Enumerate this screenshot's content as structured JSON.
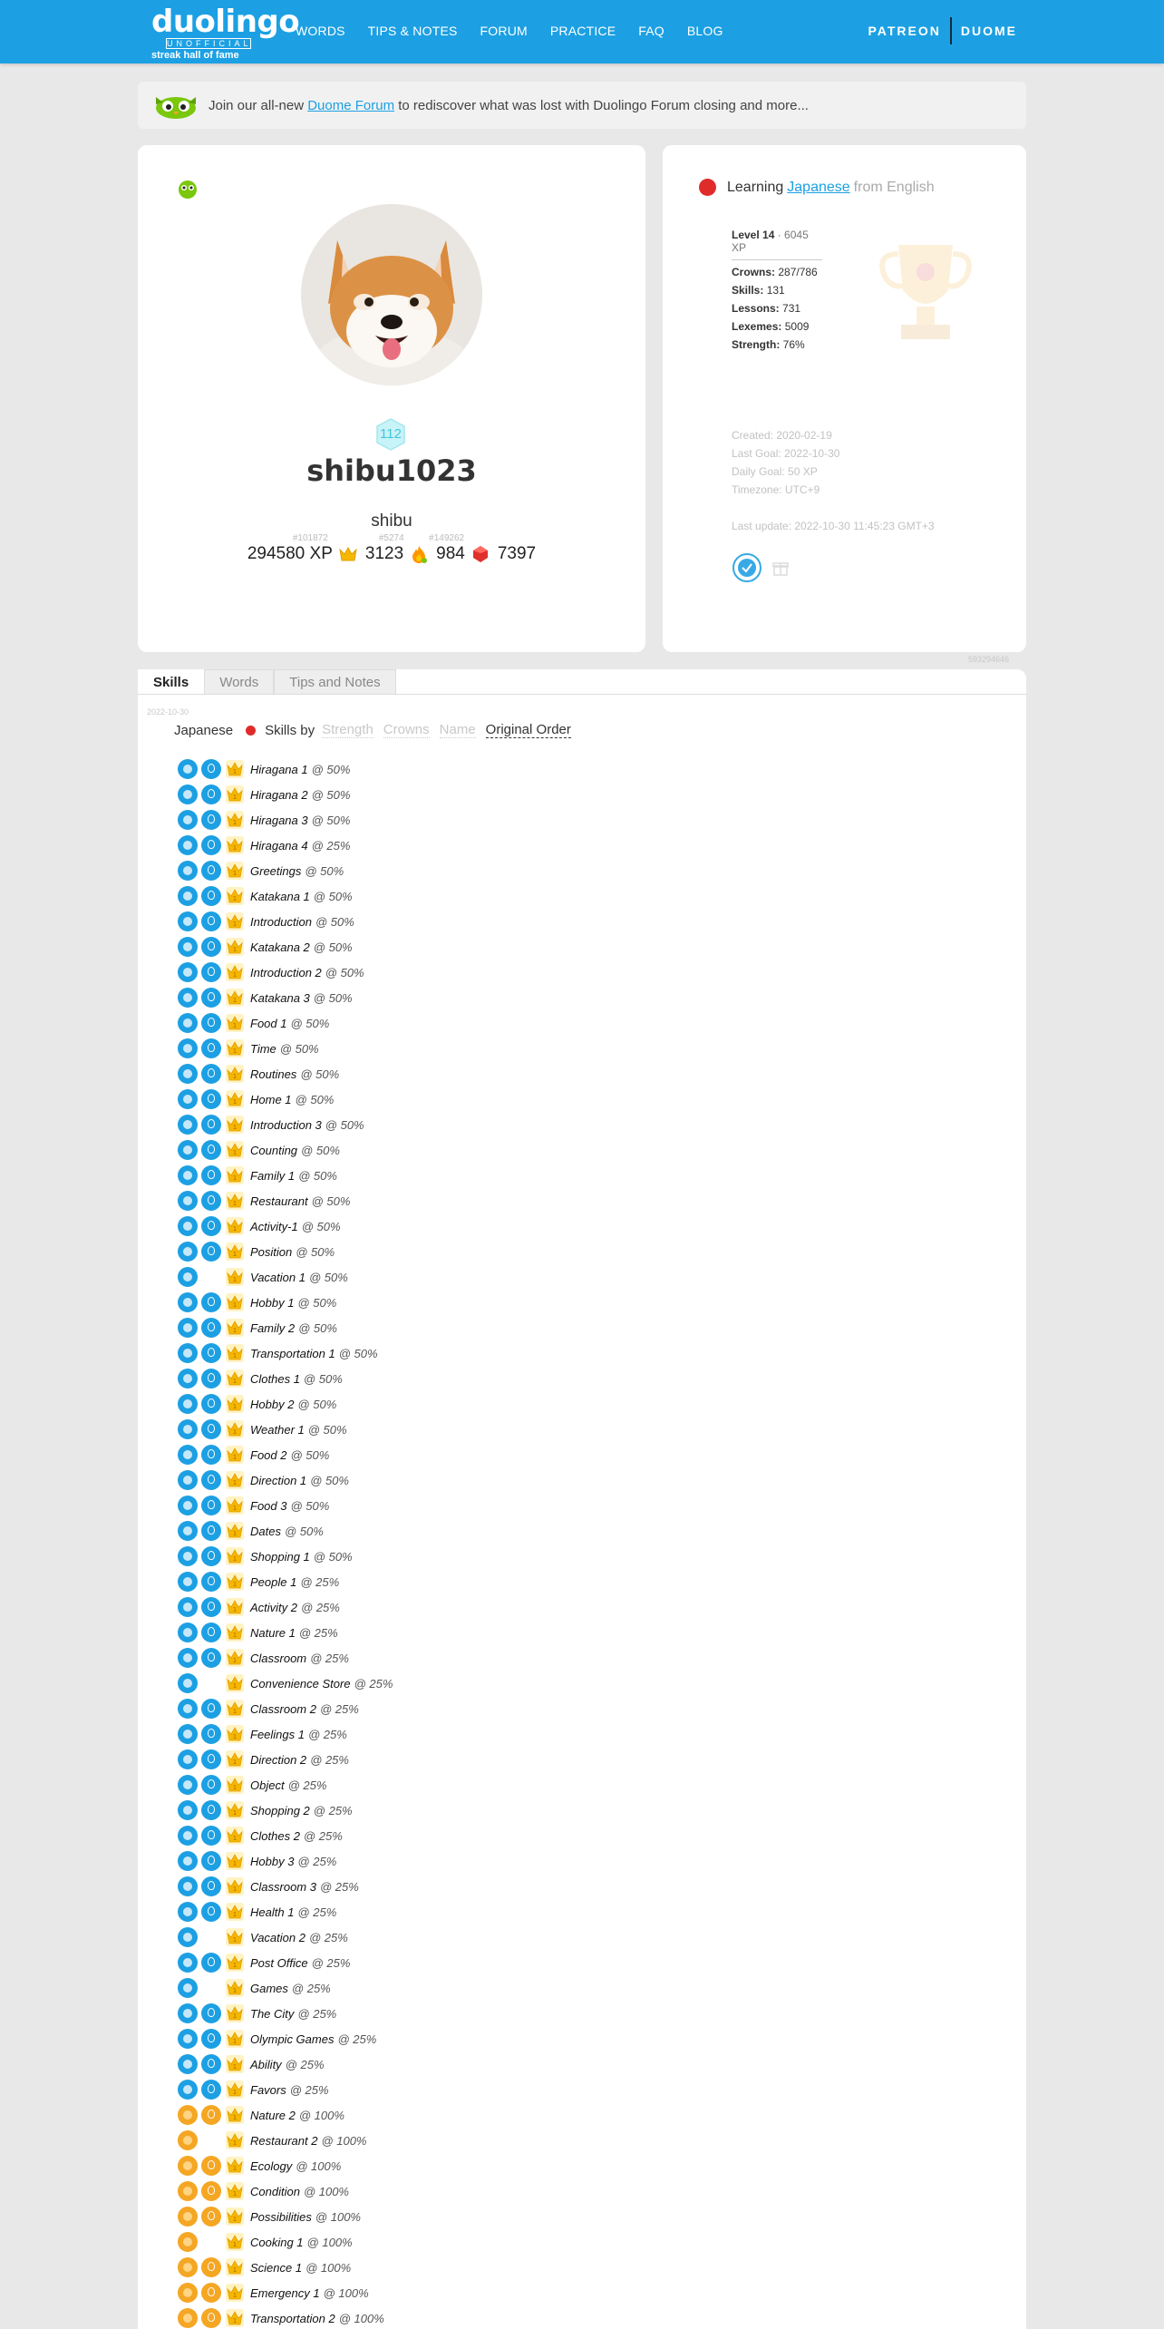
{
  "nav": {
    "logo": "duolingo",
    "logo_sub": "UNOFFICIAL",
    "logo_tag": "streak hall of fame",
    "links": [
      "WORDS",
      "TIPS & NOTES",
      "FORUM",
      "PRACTICE",
      "FAQ",
      "BLOG"
    ],
    "patreon": "PATREON",
    "duome": "DUOME"
  },
  "banner": {
    "pre": "Join our all-new ",
    "link": "Duome Forum",
    "post": " to rediscover what was lost with Duolingo Forum closing and more..."
  },
  "profile": {
    "level_badge": "112",
    "username": "shibu1023",
    "display_name": "shibu",
    "xp_rank": "#101872",
    "xp": "294580 XP",
    "crowns_rank": "#5274",
    "crowns": "3123",
    "streak_rank": "#149262",
    "streak": "984",
    "gems": "7397"
  },
  "learning": {
    "learning_label": "Learning",
    "language": "Japanese",
    "from": "from English",
    "level_label": "Level 14",
    "level_xp": "· 6045 XP",
    "crowns_label": "Crowns:",
    "crowns": "287/786",
    "skills_label": "Skills:",
    "skills": "131",
    "lessons_label": "Lessons:",
    "lessons": "731",
    "lexemes_label": "Lexemes:",
    "lexemes": "5009",
    "strength_label": "Strength:",
    "strength": "76%",
    "created": "Created: 2020-02-19",
    "last_goal": "Last Goal: 2022-10-30",
    "daily_goal": "Daily Goal: 50 XP",
    "timezone": "Timezone: UTC+9",
    "last_update": "Last update: 2022-10-30 11:45:23 GMT+3",
    "id_number": "593294646"
  },
  "skills_section": {
    "tabs": [
      "Skills",
      "Words",
      "Tips and Notes"
    ],
    "date": "2022-10-30",
    "language": "Japanese",
    "skills_by": "Skills by",
    "sort_options": [
      "Strength",
      "Crowns",
      "Name",
      "Original Order"
    ],
    "items": [
      {
        "name": "Hiragana 1",
        "pct": "@ 50%",
        "tip": "blue",
        "icon": "blue"
      },
      {
        "name": "Hiragana 2",
        "pct": "@ 50%",
        "tip": "blue",
        "icon": "blue"
      },
      {
        "name": "Hiragana 3",
        "pct": "@ 50%",
        "tip": "blue",
        "icon": "blue"
      },
      {
        "name": "Hiragana 4",
        "pct": "@ 25%",
        "tip": "blue",
        "icon": "blue"
      },
      {
        "name": "Greetings",
        "pct": "@ 50%",
        "tip": "blue",
        "icon": "blue"
      },
      {
        "name": "Katakana 1",
        "pct": "@ 50%",
        "tip": "blue",
        "icon": "blue"
      },
      {
        "name": "Introduction",
        "pct": "@ 50%",
        "tip": "blue",
        "icon": "blue"
      },
      {
        "name": "Katakana 2",
        "pct": "@ 50%",
        "tip": "blue",
        "icon": "blue"
      },
      {
        "name": "Introduction 2",
        "pct": "@ 50%",
        "tip": "blue",
        "icon": "blue"
      },
      {
        "name": "Katakana 3",
        "pct": "@ 50%",
        "tip": "blue",
        "icon": "blue"
      },
      {
        "name": "Food 1",
        "pct": "@ 50%",
        "tip": "blue",
        "icon": "blue"
      },
      {
        "name": "Time",
        "pct": "@ 50%",
        "tip": "blue",
        "icon": "blue"
      },
      {
        "name": "Routines",
        "pct": "@ 50%",
        "tip": "blue",
        "icon": "blue"
      },
      {
        "name": "Home 1",
        "pct": "@ 50%",
        "tip": "blue",
        "icon": "blue"
      },
      {
        "name": "Introduction 3",
        "pct": "@ 50%",
        "tip": "blue",
        "icon": "blue"
      },
      {
        "name": "Counting",
        "pct": "@ 50%",
        "tip": "blue",
        "icon": "blue"
      },
      {
        "name": "Family 1",
        "pct": "@ 50%",
        "tip": "blue",
        "icon": "blue"
      },
      {
        "name": "Restaurant",
        "pct": "@ 50%",
        "tip": "blue",
        "icon": "blue"
      },
      {
        "name": "Activity-1",
        "pct": "@ 50%",
        "tip": "blue",
        "icon": "blue"
      },
      {
        "name": "Position",
        "pct": "@ 50%",
        "tip": "blue",
        "icon": "blue"
      },
      {
        "name": "Vacation 1",
        "pct": "@ 50%",
        "tip": "none",
        "icon": "blue"
      },
      {
        "name": "Hobby 1",
        "pct": "@ 50%",
        "tip": "blue",
        "icon": "blue"
      },
      {
        "name": "Family 2",
        "pct": "@ 50%",
        "tip": "blue",
        "icon": "blue"
      },
      {
        "name": "Transportation 1",
        "pct": "@ 50%",
        "tip": "blue",
        "icon": "blue"
      },
      {
        "name": "Clothes 1",
        "pct": "@ 50%",
        "tip": "blue",
        "icon": "blue"
      },
      {
        "name": "Hobby 2",
        "pct": "@ 50%",
        "tip": "blue",
        "icon": "blue"
      },
      {
        "name": "Weather 1",
        "pct": "@ 50%",
        "tip": "blue",
        "icon": "blue"
      },
      {
        "name": "Food 2",
        "pct": "@ 50%",
        "tip": "blue",
        "icon": "blue"
      },
      {
        "name": "Direction 1",
        "pct": "@ 50%",
        "tip": "blue",
        "icon": "blue"
      },
      {
        "name": "Food 3",
        "pct": "@ 50%",
        "tip": "blue",
        "icon": "blue"
      },
      {
        "name": "Dates",
        "pct": "@ 50%",
        "tip": "blue",
        "icon": "blue"
      },
      {
        "name": "Shopping 1",
        "pct": "@ 50%",
        "tip": "blue",
        "icon": "blue"
      },
      {
        "name": "People 1",
        "pct": "@ 25%",
        "tip": "blue",
        "icon": "blue"
      },
      {
        "name": "Activity 2",
        "pct": "@ 25%",
        "tip": "blue",
        "icon": "blue"
      },
      {
        "name": "Nature 1",
        "pct": "@ 25%",
        "tip": "blue",
        "icon": "blue"
      },
      {
        "name": "Classroom",
        "pct": "@ 25%",
        "tip": "blue",
        "icon": "blue"
      },
      {
        "name": "Convenience Store",
        "pct": "@ 25%",
        "tip": "none",
        "icon": "blue"
      },
      {
        "name": "Classroom 2",
        "pct": "@ 25%",
        "tip": "blue",
        "icon": "blue"
      },
      {
        "name": "Feelings 1",
        "pct": "@ 25%",
        "tip": "blue",
        "icon": "blue"
      },
      {
        "name": "Direction 2",
        "pct": "@ 25%",
        "tip": "blue",
        "icon": "blue"
      },
      {
        "name": "Object",
        "pct": "@ 25%",
        "tip": "blue",
        "icon": "blue"
      },
      {
        "name": "Shopping 2",
        "pct": "@ 25%",
        "tip": "blue",
        "icon": "blue"
      },
      {
        "name": "Clothes 2",
        "pct": "@ 25%",
        "tip": "blue",
        "icon": "blue"
      },
      {
        "name": "Hobby 3",
        "pct": "@ 25%",
        "tip": "blue",
        "icon": "blue"
      },
      {
        "name": "Classroom 3",
        "pct": "@ 25%",
        "tip": "blue",
        "icon": "blue"
      },
      {
        "name": "Health 1",
        "pct": "@ 25%",
        "tip": "blue",
        "icon": "blue"
      },
      {
        "name": "Vacation 2",
        "pct": "@ 25%",
        "tip": "none",
        "icon": "blue"
      },
      {
        "name": "Post Office",
        "pct": "@ 25%",
        "tip": "blue",
        "icon": "blue"
      },
      {
        "name": "Games",
        "pct": "@ 25%",
        "tip": "none",
        "icon": "blue"
      },
      {
        "name": "The City",
        "pct": "@ 25%",
        "tip": "blue",
        "icon": "blue"
      },
      {
        "name": "Olympic Games",
        "pct": "@ 25%",
        "tip": "blue",
        "icon": "blue"
      },
      {
        "name": "Ability",
        "pct": "@ 25%",
        "tip": "blue",
        "icon": "blue"
      },
      {
        "name": "Favors",
        "pct": "@ 25%",
        "tip": "blue",
        "icon": "blue"
      },
      {
        "name": "Nature 2",
        "pct": "@ 100%",
        "tip": "gold",
        "icon": "gold"
      },
      {
        "name": "Restaurant 2",
        "pct": "@ 100%",
        "tip": "none",
        "icon": "gold"
      },
      {
        "name": "Ecology",
        "pct": "@ 100%",
        "tip": "gold",
        "icon": "gold"
      },
      {
        "name": "Condition",
        "pct": "@ 100%",
        "tip": "gold",
        "icon": "gold"
      },
      {
        "name": "Possibilities",
        "pct": "@ 100%",
        "tip": "gold",
        "icon": "gold"
      },
      {
        "name": "Cooking 1",
        "pct": "@ 100%",
        "tip": "none",
        "icon": "gold"
      },
      {
        "name": "Science 1",
        "pct": "@ 100%",
        "tip": "gold",
        "icon": "gold"
      },
      {
        "name": "Emergency 1",
        "pct": "@ 100%",
        "tip": "gold",
        "icon": "gold"
      },
      {
        "name": "Transportation 2",
        "pct": "@ 100%",
        "tip": "gold",
        "icon": "gold"
      }
    ]
  },
  "colors": {
    "nav_blue": "#1ca0e3",
    "link_blue": "#1ca0e3",
    "red_dot": "#e02b2b",
    "crown_gold": "#f5a623",
    "page_bg": "#e8e8e8"
  }
}
